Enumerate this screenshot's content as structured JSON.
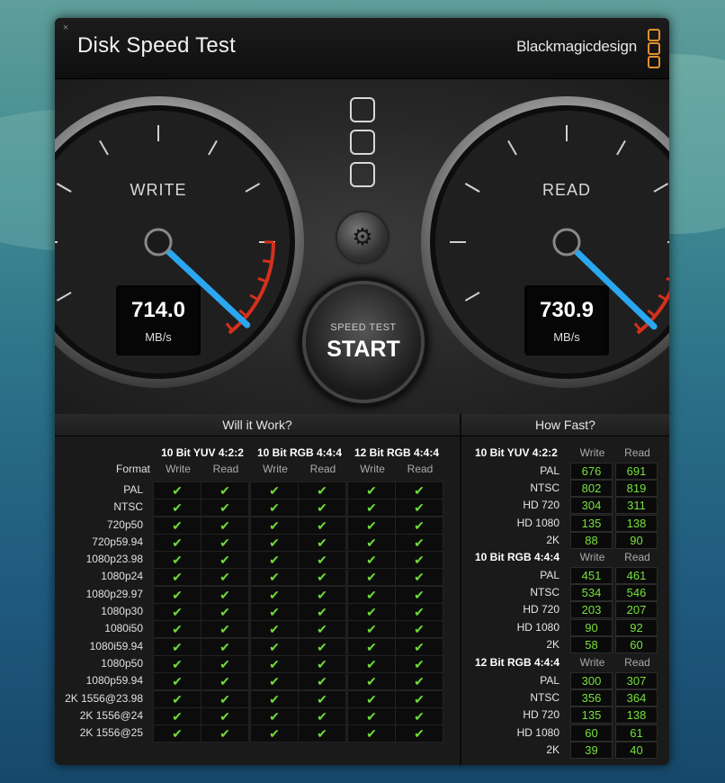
{
  "window": {
    "close_glyph": "×",
    "title": "Disk Speed Test",
    "brand": "Blackmagicdesign"
  },
  "gauges": {
    "write": {
      "title": "WRITE",
      "value": "714.0",
      "unit": "MB/s"
    },
    "read": {
      "title": "READ",
      "value": "730.9",
      "unit": "MB/s"
    }
  },
  "start_button": {
    "line1": "SPEED TEST",
    "line2": "START"
  },
  "settings_icon": "gear-icon",
  "will_it_work": {
    "title": "Will it Work?",
    "format_label": "Format",
    "groups": [
      "10 Bit YUV 4:2:2",
      "10 Bit RGB 4:4:4",
      "12 Bit RGB 4:4:4"
    ],
    "subcols": [
      "Write",
      "Read"
    ],
    "check_glyph": "✔",
    "formats": [
      "PAL",
      "NTSC",
      "720p50",
      "720p59.94",
      "1080p23.98",
      "1080p24",
      "1080p29.97",
      "1080p30",
      "1080i50",
      "1080i59.94",
      "1080p50",
      "1080p59.94",
      "2K 1556@23.98",
      "2K 1556@24",
      "2K 1556@25"
    ]
  },
  "how_fast": {
    "title": "How Fast?",
    "write_label": "Write",
    "read_label": "Read",
    "sections": [
      {
        "name": "10 Bit YUV 4:2:2",
        "rows": [
          {
            "label": "PAL",
            "write": "676",
            "read": "691"
          },
          {
            "label": "NTSC",
            "write": "802",
            "read": "819"
          },
          {
            "label": "HD 720",
            "write": "304",
            "read": "311"
          },
          {
            "label": "HD 1080",
            "write": "135",
            "read": "138"
          },
          {
            "label": "2K",
            "write": "88",
            "read": "90"
          }
        ]
      },
      {
        "name": "10 Bit RGB 4:4:4",
        "rows": [
          {
            "label": "PAL",
            "write": "451",
            "read": "461"
          },
          {
            "label": "NTSC",
            "write": "534",
            "read": "546"
          },
          {
            "label": "HD 720",
            "write": "203",
            "read": "207"
          },
          {
            "label": "HD 1080",
            "write": "90",
            "read": "92"
          },
          {
            "label": "2K",
            "write": "58",
            "read": "60"
          }
        ]
      },
      {
        "name": "12 Bit RGB 4:4:4",
        "rows": [
          {
            "label": "PAL",
            "write": "300",
            "read": "307"
          },
          {
            "label": "NTSC",
            "write": "356",
            "read": "364"
          },
          {
            "label": "HD 720",
            "write": "135",
            "read": "138"
          },
          {
            "label": "HD 1080",
            "write": "60",
            "read": "61"
          },
          {
            "label": "2K",
            "write": "39",
            "read": "40"
          }
        ]
      }
    ]
  },
  "colors": {
    "accent_needle": "#2aa7f0",
    "check_green": "#6edb3b",
    "value_green": "#74e23a",
    "brand_orange": "#e3902f",
    "redline": "#d5301c"
  }
}
